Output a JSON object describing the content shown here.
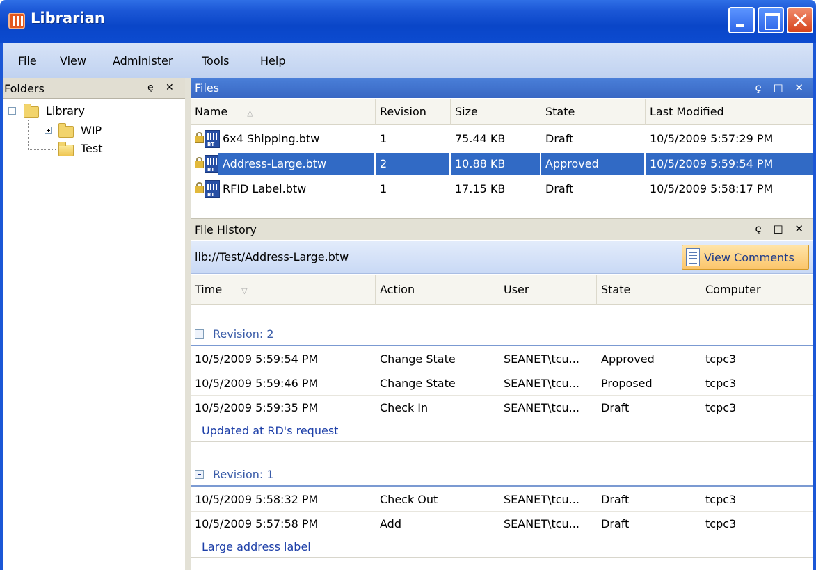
{
  "window": {
    "title": "Librarian"
  },
  "menu": [
    "File",
    "View",
    "Administer",
    "Tools",
    "Help"
  ],
  "folders": {
    "title": "Folders",
    "pin": "ȩ",
    "close": "✕",
    "tree": {
      "root": "Library",
      "children": [
        "WIP",
        "Test"
      ]
    }
  },
  "files": {
    "title": "Files",
    "icons": "ȩ □ ✕",
    "columns": [
      "Name",
      "Revision",
      "Size",
      "State",
      "Last Modified"
    ],
    "rows": [
      {
        "name": "6x4 Shipping.btw",
        "revision": "1",
        "size": "75.44 KB",
        "state": "Draft",
        "modified": "10/5/2009 5:57:29 PM"
      },
      {
        "name": "Address-Large.btw",
        "revision": "2",
        "size": "10.88 KB",
        "state": "Approved",
        "modified": "10/5/2009 5:59:54 PM"
      },
      {
        "name": "RFID Label.btw",
        "revision": "1",
        "size": "17.15 KB",
        "state": "Draft",
        "modified": "10/5/2009 5:58:17 PM"
      }
    ]
  },
  "history": {
    "title": "File History",
    "icons": "ȩ □ ✕",
    "path": "lib://Test/Address-Large.btw",
    "view_comments": "View Comments",
    "columns": [
      "Time",
      "Action",
      "User",
      "State",
      "Computer"
    ],
    "groups": [
      {
        "label": "Revision: 2",
        "rows": [
          {
            "time": "10/5/2009 5:59:54 PM",
            "action": "Change State",
            "user": "SEANET\\tcu...",
            "state": "Approved",
            "computer": "tcpc3"
          },
          {
            "time": "10/5/2009 5:59:46 PM",
            "action": "Change State",
            "user": "SEANET\\tcu...",
            "state": "Proposed",
            "computer": "tcpc3"
          },
          {
            "time": "10/5/2009 5:59:35 PM",
            "action": "Check In",
            "user": "SEANET\\tcu...",
            "state": "Draft",
            "computer": "tcpc3"
          }
        ],
        "comment": "Updated at RD's request"
      },
      {
        "label": "Revision: 1",
        "rows": [
          {
            "time": "10/5/2009 5:58:32 PM",
            "action": "Check Out",
            "user": "SEANET\\tcu...",
            "state": "Draft",
            "computer": "tcpc3"
          },
          {
            "time": "10/5/2009 5:57:58 PM",
            "action": "Add",
            "user": "SEANET\\tcu...",
            "state": "Draft",
            "computer": "tcpc3"
          }
        ],
        "comment": "Large address label"
      }
    ]
  },
  "colors": {
    "selection": "#316ac5",
    "titlebar": "#0a46c8",
    "comment": "#1d3fa8"
  }
}
